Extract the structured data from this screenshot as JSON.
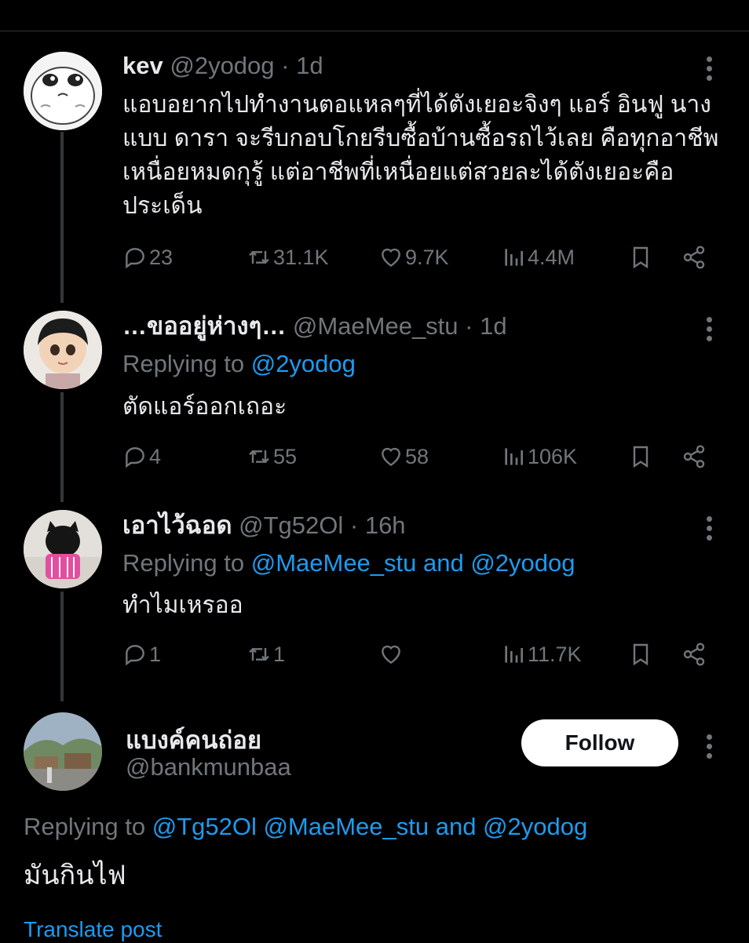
{
  "tweets": [
    {
      "name": "kev",
      "handle": "@2yodog",
      "time": "· 1d",
      "text": "แอบอยากไปทำงานตอแหลๆที่ได้ตังเยอะจิงๆ แอร์ อินฟู นาง แบบ ดารา จะรีบกอบโกยรีบซื้อบ้านซื้อรถไว้เลย คือทุกอาชีพเหนื่อยหมดกุรู้ แต่อาชีพที่เหนื่อยแต่สวยละได้ตังเยอะคือประเด็น",
      "stats": {
        "replies": "23",
        "reposts": "31.1K",
        "likes": "9.7K",
        "views": "4.4M"
      }
    },
    {
      "name": "…ขออยู่ห่างๆ…",
      "handle": "@MaeMee_stu",
      "time": "· 1d",
      "replying_prefix": "Replying to",
      "replying_to": "@2yodog",
      "text": "ตัดแอร์ออกเถอะ",
      "stats": {
        "replies": "4",
        "reposts": "55",
        "likes": "58",
        "views": "106K"
      }
    },
    {
      "name": "เอาไว้ฉอด",
      "handle": "@Tg52Ol",
      "time": "· 16h",
      "replying_prefix": "Replying to",
      "replying_to": "@MaeMee_stu and @2yodog",
      "text": "ทำไมเหรออ",
      "stats": {
        "replies": "1",
        "reposts": "1",
        "likes": "",
        "views": "11.7K"
      }
    }
  ],
  "focused": {
    "name": "แบงค์คนถ่อย",
    "handle": "@bankmunbaa",
    "follow_label": "Follow",
    "replying_prefix": "Replying to",
    "replying_to": "@Tg52Ol @MaeMee_stu and @2yodog",
    "text": "มันกินไฟ",
    "translate_label": "Translate post"
  },
  "icons": {
    "reply": "reply-icon",
    "repost": "repost-icon",
    "like": "heart-icon",
    "views": "views-icon",
    "bookmark": "bookmark-icon",
    "share": "share-icon",
    "more": "more-icon"
  },
  "colors": {
    "background": "#000000",
    "text": "#e7e9ea",
    "muted": "#71767b",
    "link": "#1d9bf0"
  }
}
